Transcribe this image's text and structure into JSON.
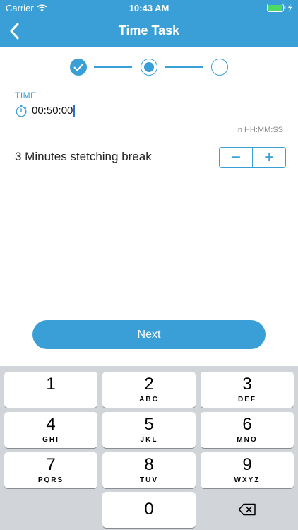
{
  "status_bar": {
    "carrier": "Carrier",
    "time": "10:43 AM"
  },
  "nav": {
    "title": "Time Task",
    "back_icon": "chevron-left-icon"
  },
  "stepper": {
    "steps": [
      "completed",
      "current",
      "upcoming"
    ]
  },
  "form": {
    "time_label": "TIME",
    "time_value": "00:50:00",
    "time_hint": "in HH:MM:SS",
    "task_label": "3 Minutes stetching break",
    "minus": "−",
    "plus": "+"
  },
  "next_label": "Next",
  "keypad": {
    "keys": [
      {
        "digit": "1",
        "letters": ""
      },
      {
        "digit": "2",
        "letters": "ABC"
      },
      {
        "digit": "3",
        "letters": "DEF"
      },
      {
        "digit": "4",
        "letters": "GHI"
      },
      {
        "digit": "5",
        "letters": "JKL"
      },
      {
        "digit": "6",
        "letters": "MNO"
      },
      {
        "digit": "7",
        "letters": "PQRS"
      },
      {
        "digit": "8",
        "letters": "TUV"
      },
      {
        "digit": "9",
        "letters": "WXYZ"
      },
      {
        "digit": "0",
        "letters": ""
      }
    ]
  },
  "colors": {
    "accent": "#3a9fd6",
    "keyboard_bg": "#d1d4d9"
  }
}
